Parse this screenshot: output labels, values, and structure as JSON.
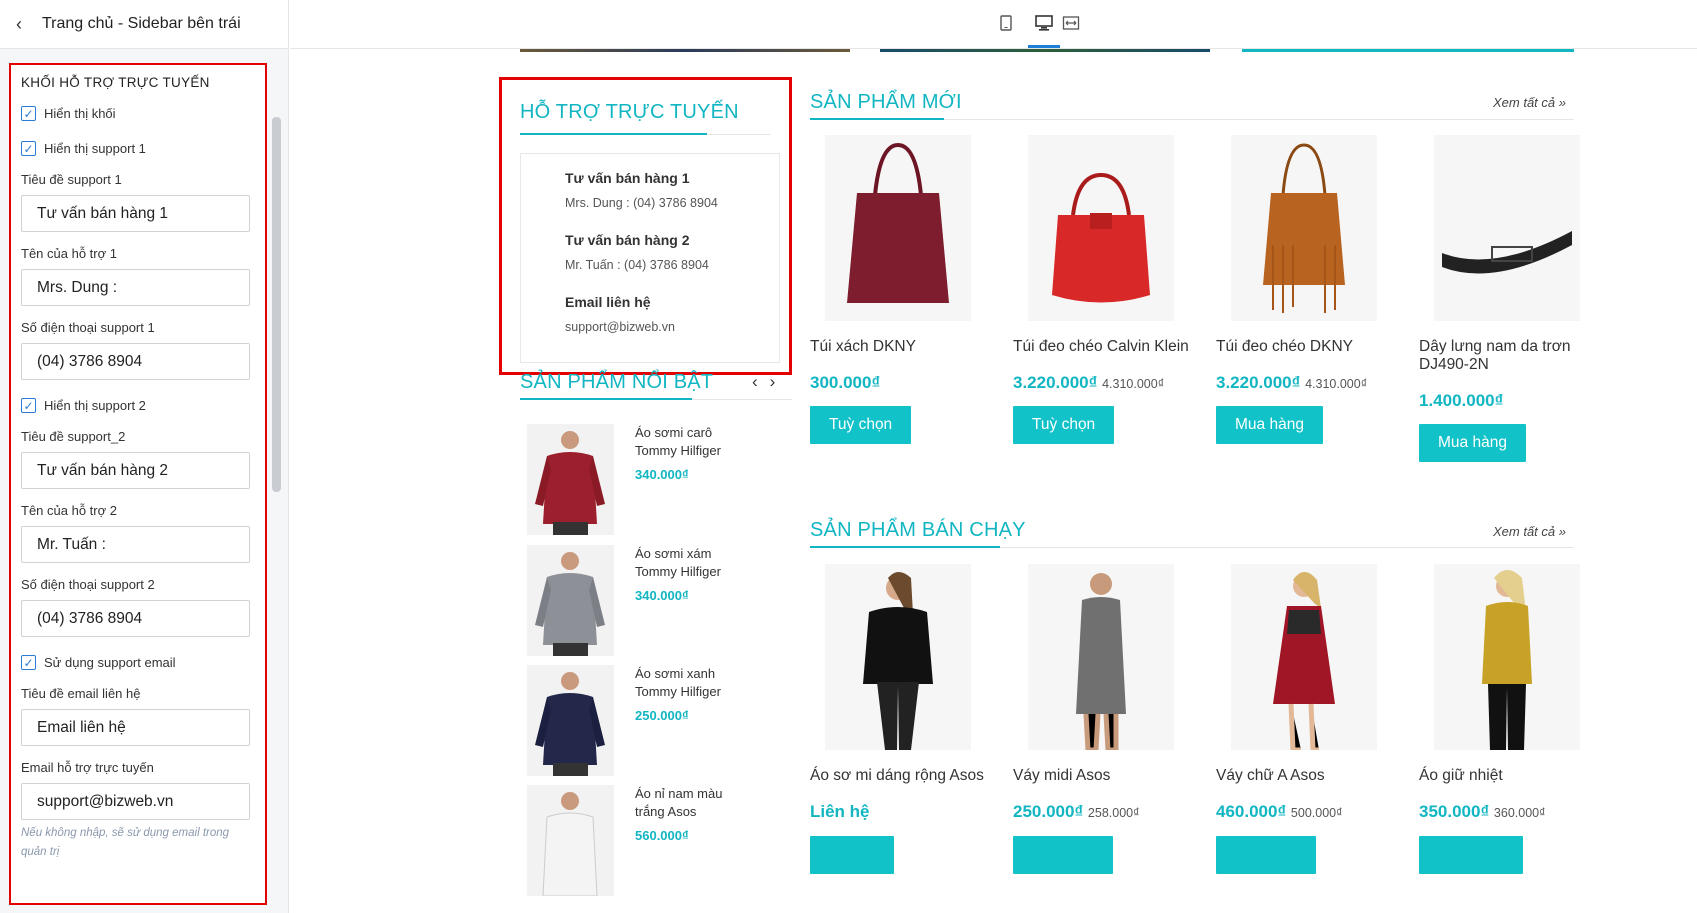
{
  "panel": {
    "title": "Trang chủ - Sidebar bên trái",
    "section_title": "KHỐI HỖ TRỢ TRỰC TUYẾN",
    "show_block": "Hiển thị khối",
    "show_support1": "Hiển thị support 1",
    "support1_title_label": "Tiêu đề support 1",
    "support1_title": "Tư vấn bán hàng 1",
    "support1_name_label": "Tên của hỗ trợ 1",
    "support1_name": "Mrs. Dung :",
    "support1_phone_label": "Số điện thoại support 1",
    "support1_phone": "(04) 3786 8904",
    "show_support2": "Hiển thị support 2",
    "support2_title_label": "Tiêu đề support_2",
    "support2_title": "Tư vấn bán hàng 2",
    "support2_name_label": "Tên của hỗ trợ 2",
    "support2_name": "Mr. Tuấn :",
    "support2_phone_label": "Số điện thoại support 2",
    "support2_phone": "(04) 3786 8904",
    "use_email": "Sử dụng support email",
    "email_title_label": "Tiêu đề email liên hệ",
    "email_title": "Email liên hệ",
    "email_label": "Email hỗ trợ trực tuyến",
    "email": "support@bizweb.vn",
    "hint": "Nếu không nhập, sẽ sử dụng email trong quản trị"
  },
  "support_box": {
    "title": "HỖ TRỢ TRỰC TUYẾN",
    "items": [
      {
        "name": "Tư vấn bán hàng 1",
        "value": "Mrs. Dung : (04) 3786 8904"
      },
      {
        "name": "Tư vấn bán hàng 2",
        "value": "Mr. Tuấn : (04) 3786 8904"
      },
      {
        "name": "Email liên hệ",
        "value": "support@bizweb.vn"
      }
    ]
  },
  "featured": {
    "title": "SẢN PHẨM NỔI BẬT",
    "prev": "‹",
    "next": "›",
    "items": [
      {
        "name": "Áo sơmi carô Tommy Hilfiger",
        "price": "340.000₫"
      },
      {
        "name": "Áo sơmi xám Tommy Hilfiger",
        "price": "340.000₫"
      },
      {
        "name": "Áo sơmi xanh Tommy Hilfiger",
        "price": "250.000₫"
      },
      {
        "name": "Áo nỉ nam màu trắng Asos",
        "price": "560.000₫"
      }
    ]
  },
  "new_products": {
    "title": "SẢN PHẨM MỚI",
    "see_all": "Xem tất cả »",
    "items": [
      {
        "name": "Túi xách DKNY",
        "price": "300.000₫",
        "old_price": "",
        "button": "Tuỳ chọn"
      },
      {
        "name": "Túi đeo chéo Calvin Klein",
        "price": "3.220.000₫",
        "old_price": "4.310.000₫",
        "button": "Tuỳ chọn"
      },
      {
        "name": "Túi đeo chéo DKNY",
        "price": "3.220.000₫",
        "old_price": "4.310.000₫",
        "button": "Mua hàng"
      },
      {
        "name": "Dây lưng nam da trơn DJ490-2N",
        "price": "1.400.000₫",
        "old_price": "",
        "button": "Mua hàng"
      }
    ]
  },
  "best_sellers": {
    "title": "SẢN PHẨM BÁN CHẠY",
    "see_all": "Xem tất cả »",
    "items": [
      {
        "name": "Áo sơ mi dáng rộng Asos",
        "price": "Liên hệ",
        "old_price": ""
      },
      {
        "name": "Váy midi Asos",
        "price": "250.000₫",
        "old_price": "258.000₫"
      },
      {
        "name": "Váy chữ A Asos",
        "price": "460.000₫",
        "old_price": "500.000₫"
      },
      {
        "name": "Áo giữ nhiệt",
        "price": "350.000₫",
        "old_price": "360.000₫"
      }
    ]
  },
  "colors": {
    "accent": "#11b6c2",
    "button": "#11c2c8",
    "highlight_border": "#e30000",
    "checkbox": "#2a7dd6"
  }
}
